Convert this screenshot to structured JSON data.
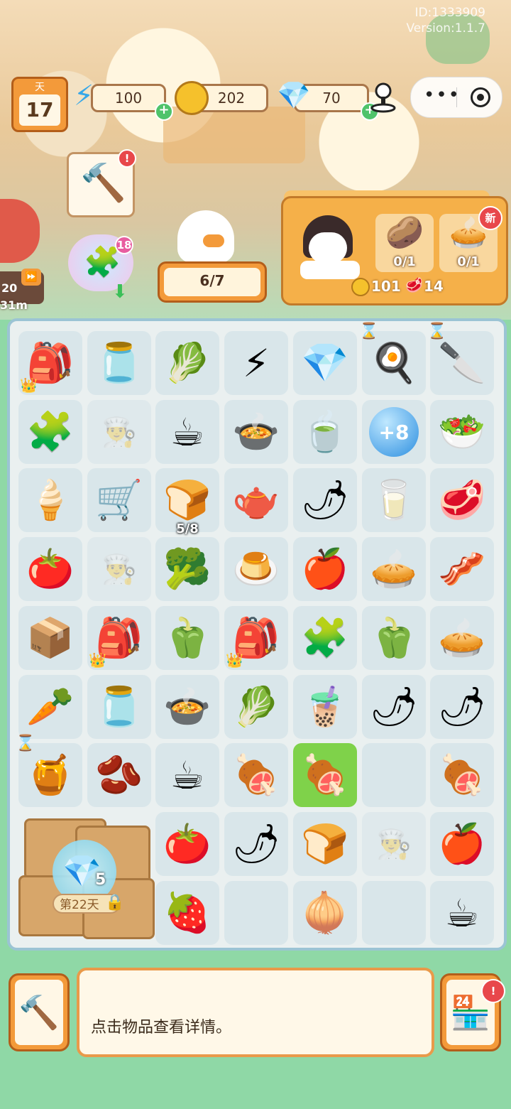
{
  "system": {
    "id_text": "ID:1333909",
    "version_text": "Version:1.1.7"
  },
  "hud": {
    "day_label": "天",
    "day_value": "17",
    "energy": "100",
    "coins": "202",
    "gems": "70"
  },
  "worker": {
    "count": "6/7"
  },
  "side": {
    "value": "20",
    "distance": "31m"
  },
  "tool_bubble": {
    "badge": "!"
  },
  "spawn": {
    "count": "18"
  },
  "order": {
    "new_badge": "新",
    "items": [
      {
        "icon": "potato-icon",
        "progress": "0/1"
      },
      {
        "icon": "pie-icon",
        "progress": "0/1"
      }
    ],
    "reward_coins": "101",
    "reward_meat": "14"
  },
  "board": {
    "rows": [
      [
        {
          "icon": "backpack-icon",
          "glyph": "🎒",
          "crown": true
        },
        {
          "icon": "glass-jar-icon",
          "glyph": "🫙"
        },
        {
          "icon": "lettuce-plate-icon",
          "glyph": "🥬"
        },
        {
          "icon": "energy-icon",
          "glyph": "⚡"
        },
        {
          "icon": "ruby-icon",
          "glyph": "💎"
        },
        {
          "icon": "grill-tray-icon",
          "glyph": "🍳",
          "timer": true
        },
        {
          "icon": "cutting-board-icon",
          "glyph": "🔪",
          "timer": true
        }
      ],
      [
        {
          "icon": "blue-puzzle-icon",
          "glyph": "🧩"
        },
        {
          "icon": "empty-chef-icon",
          "glyph": "",
          "empty": true
        },
        {
          "icon": "latte-cup-icon",
          "glyph": "☕"
        },
        {
          "icon": "soup-bowl-icon",
          "glyph": "🍲"
        },
        {
          "icon": "green-tea-icon",
          "glyph": "🍵"
        },
        {
          "icon": "plus8-orb-icon",
          "glyph": "+8"
        },
        {
          "icon": "salad-icon",
          "glyph": "🥗"
        }
      ],
      [
        {
          "icon": "cream-bowl-icon",
          "glyph": "🍦"
        },
        {
          "icon": "food-cart-icon",
          "glyph": "🛒"
        },
        {
          "icon": "toaster-icon",
          "glyph": "🍞",
          "count": "5/8"
        },
        {
          "icon": "tea-cup-icon",
          "glyph": "🫖"
        },
        {
          "icon": "chili-plate-icon",
          "glyph": "🌶"
        },
        {
          "icon": "measuring-cup-icon",
          "glyph": "🥛"
        },
        {
          "icon": "roast-meat-icon",
          "glyph": "🥩"
        }
      ],
      [
        {
          "icon": "tomato-icon",
          "glyph": "🍅"
        },
        {
          "icon": "empty-chef-icon",
          "glyph": "",
          "empty": true
        },
        {
          "icon": "cauliflower-icon",
          "glyph": "🥦"
        },
        {
          "icon": "coffee-pudding-icon",
          "glyph": "🍮"
        },
        {
          "icon": "apples-icon",
          "glyph": "🍎"
        },
        {
          "icon": "tart-icon",
          "glyph": "🥧"
        },
        {
          "icon": "bacon-icon",
          "glyph": "🥓"
        }
      ],
      [
        {
          "icon": "toaster-blue-icon",
          "glyph": "📦"
        },
        {
          "icon": "backpack-icon",
          "glyph": "🎒",
          "crown": true
        },
        {
          "icon": "bell-peppers-icon",
          "glyph": "🫑"
        },
        {
          "icon": "backpack-icon",
          "glyph": "🎒",
          "crown": true
        },
        {
          "icon": "blue-puzzle-icon",
          "glyph": "🧩"
        },
        {
          "icon": "bell-peppers-icon",
          "glyph": "🫑"
        },
        {
          "icon": "tart-shell-icon",
          "glyph": "🥧"
        }
      ],
      [
        {
          "icon": "carrot-icon",
          "glyph": "🥕"
        },
        {
          "icon": "glass-jar-icon",
          "glyph": "🫙"
        },
        {
          "icon": "soup-bowl-icon",
          "glyph": "🍲"
        },
        {
          "icon": "lettuce-plate-icon",
          "glyph": "🥬"
        },
        {
          "icon": "iced-coffee-icon",
          "glyph": "🧋"
        },
        {
          "icon": "chili-plate-icon",
          "glyph": "🌶"
        },
        {
          "icon": "chili-plate-icon",
          "glyph": "🌶"
        }
      ],
      [
        {
          "icon": "blender-icon",
          "glyph": "🍯",
          "timer": true
        },
        {
          "icon": "coffee-beans-icon",
          "glyph": "🫘"
        },
        {
          "icon": "coffee-cup-icon",
          "glyph": "☕"
        },
        {
          "icon": "raw-meat-icon",
          "glyph": "🍖"
        },
        {
          "icon": "raw-meat-icon",
          "glyph": "🍖",
          "selected": true
        },
        {
          "icon": "empty-icon",
          "glyph": "",
          "blank": true
        },
        {
          "icon": "ham-icon",
          "glyph": "🍖"
        }
      ],
      [
        {
          "icon": "locked-crates-icon",
          "glyph": "",
          "blank": true
        },
        {
          "icon": "locked-crates-icon",
          "glyph": "",
          "blank": true
        },
        {
          "icon": "tomato-icon",
          "glyph": "🍅"
        },
        {
          "icon": "chili-plate-icon",
          "glyph": "🌶"
        },
        {
          "icon": "toast-plate-icon",
          "glyph": "🍞"
        },
        {
          "icon": "empty-chef-icon",
          "glyph": "",
          "empty": true
        },
        {
          "icon": "apples-icon",
          "glyph": "🍎"
        }
      ],
      [
        {
          "icon": "locked-crates-icon",
          "glyph": "",
          "blank": true
        },
        {
          "icon": "locked-crates-icon",
          "glyph": "",
          "blank": true
        },
        {
          "icon": "strawberry-icon",
          "glyph": "🍓"
        },
        {
          "icon": "empty-icon",
          "glyph": "",
          "blank": true
        },
        {
          "icon": "onion-icon",
          "glyph": "🧅"
        },
        {
          "icon": "empty-icon",
          "glyph": "",
          "blank": true
        },
        {
          "icon": "coffee-cup-icon",
          "glyph": "☕"
        }
      ]
    ],
    "locked_reward": {
      "count": "5",
      "label": "第22天"
    }
  },
  "bottom": {
    "message": "点击物品查看详情。",
    "shop_badge": "!"
  }
}
